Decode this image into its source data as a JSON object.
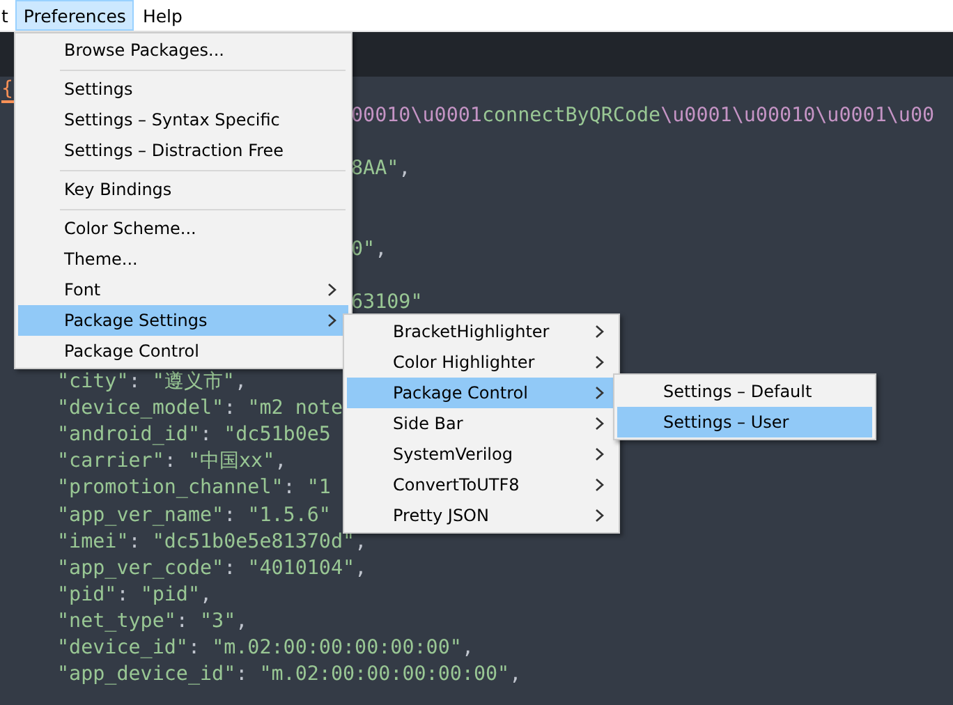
{
  "menu_bar": [
    {
      "label": "t",
      "selected": false
    },
    {
      "label": "Preferences",
      "selected": true
    },
    {
      "label": "Help",
      "selected": false
    }
  ],
  "preferences_menu": {
    "items": [
      {
        "kind": "item",
        "label": "Browse Packages...",
        "selected": false,
        "has_submenu": false
      },
      {
        "kind": "separator"
      },
      {
        "kind": "item",
        "label": "Settings",
        "selected": false,
        "has_submenu": false
      },
      {
        "kind": "item",
        "label": "Settings – Syntax Specific",
        "selected": false,
        "has_submenu": false
      },
      {
        "kind": "item",
        "label": "Settings – Distraction Free",
        "selected": false,
        "has_submenu": false
      },
      {
        "kind": "separator"
      },
      {
        "kind": "item",
        "label": "Key Bindings",
        "selected": false,
        "has_submenu": false
      },
      {
        "kind": "separator"
      },
      {
        "kind": "item",
        "label": "Color Scheme...",
        "selected": false,
        "has_submenu": false
      },
      {
        "kind": "item",
        "label": "Theme...",
        "selected": false,
        "has_submenu": false
      },
      {
        "kind": "item",
        "label": "Font",
        "selected": false,
        "has_submenu": true
      },
      {
        "kind": "item",
        "label": "Package Settings",
        "selected": true,
        "has_submenu": true
      },
      {
        "kind": "item",
        "label": "Package Control",
        "selected": false,
        "has_submenu": false
      }
    ]
  },
  "package_settings_submenu": {
    "items": [
      {
        "kind": "item",
        "label": "BracketHighlighter",
        "selected": false,
        "has_submenu": true
      },
      {
        "kind": "item",
        "label": "Color Highlighter",
        "selected": false,
        "has_submenu": true
      },
      {
        "kind": "item",
        "label": "Package Control",
        "selected": true,
        "has_submenu": true
      },
      {
        "kind": "item",
        "label": "Side Bar",
        "selected": false,
        "has_submenu": true
      },
      {
        "kind": "item",
        "label": "SystemVerilog",
        "selected": false,
        "has_submenu": true
      },
      {
        "kind": "item",
        "label": "ConvertToUTF8",
        "selected": false,
        "has_submenu": true
      },
      {
        "kind": "item",
        "label": "Pretty JSON",
        "selected": false,
        "has_submenu": true
      }
    ]
  },
  "package_control_submenu": {
    "items": [
      {
        "kind": "item",
        "label": "Settings – Default",
        "selected": false,
        "has_submenu": false
      },
      {
        "kind": "item",
        "label": "Settings – User",
        "selected": true,
        "has_submenu": false
      }
    ]
  },
  "editor": {
    "lines": [
      {
        "kind": "top",
        "tokens": [
          {
            "text": "{",
            "kind": "brace"
          }
        ]
      },
      {
        "kind": "after-menu",
        "tokens": [
          {
            "text": "00010\\u0001",
            "kind": "escape"
          },
          {
            "text": "connectByQRCode",
            "kind": "string"
          },
          {
            "text": "\\u0001\\u00010\\u0001\\u00",
            "kind": "escape"
          }
        ]
      },
      {
        "kind": "blank"
      },
      {
        "kind": "after-menu",
        "tokens": [
          {
            "text": "8AA\"",
            "kind": "string"
          },
          {
            "text": ",",
            "kind": "punctuation"
          }
        ]
      },
      {
        "kind": "blank"
      },
      {
        "kind": "blank"
      },
      {
        "kind": "after-menu",
        "tokens": [
          {
            "text": "0\"",
            "kind": "string"
          },
          {
            "text": ",",
            "kind": "punctuation"
          }
        ]
      },
      {
        "kind": "blank"
      },
      {
        "kind": "after-menu",
        "tokens": [
          {
            "text": "63109\"",
            "kind": "string"
          }
        ]
      },
      {
        "kind": "blank"
      },
      {
        "kind": "blank"
      },
      {
        "kind": "indented",
        "tokens": [
          {
            "text": "\"city\"",
            "kind": "string"
          },
          {
            "text": ": ",
            "kind": "punctuation"
          },
          {
            "text": "\"遵义市\"",
            "kind": "string"
          },
          {
            "text": ",",
            "kind": "punctuation"
          }
        ]
      },
      {
        "kind": "indented",
        "tokens": [
          {
            "text": "\"device_model\"",
            "kind": "string"
          },
          {
            "text": ": ",
            "kind": "punctuation"
          },
          {
            "text": "\"m2 note",
            "kind": "string"
          }
        ]
      },
      {
        "kind": "indented",
        "tokens": [
          {
            "text": "\"android_id\"",
            "kind": "string"
          },
          {
            "text": ": ",
            "kind": "punctuation"
          },
          {
            "text": "\"dc51b0e5",
            "kind": "string"
          }
        ]
      },
      {
        "kind": "indented",
        "tokens": [
          {
            "text": "\"carrier\"",
            "kind": "string"
          },
          {
            "text": ": ",
            "kind": "punctuation"
          },
          {
            "text": "\"中国xx\"",
            "kind": "string"
          },
          {
            "text": ",",
            "kind": "punctuation"
          }
        ]
      },
      {
        "kind": "indented",
        "tokens": [
          {
            "text": "\"promotion_channel\"",
            "kind": "string"
          },
          {
            "text": ": ",
            "kind": "punctuation"
          },
          {
            "text": "\"1",
            "kind": "string"
          }
        ]
      },
      {
        "kind": "indented",
        "tokens": [
          {
            "text": "\"app_ver_name\"",
            "kind": "string"
          },
          {
            "text": ": ",
            "kind": "punctuation"
          },
          {
            "text": "\"1.5.6\"",
            "kind": "string"
          }
        ]
      },
      {
        "kind": "indented",
        "tokens": [
          {
            "text": "\"imei\"",
            "kind": "string"
          },
          {
            "text": ": ",
            "kind": "punctuation"
          },
          {
            "text": "\"dc51b0e5e81370d\"",
            "kind": "string"
          },
          {
            "text": ",",
            "kind": "punctuation"
          }
        ]
      },
      {
        "kind": "indented",
        "tokens": [
          {
            "text": "\"app_ver_code\"",
            "kind": "string"
          },
          {
            "text": ": ",
            "kind": "punctuation"
          },
          {
            "text": "\"4010104\"",
            "kind": "string"
          },
          {
            "text": ",",
            "kind": "punctuation"
          }
        ]
      },
      {
        "kind": "indented",
        "tokens": [
          {
            "text": "\"pid\"",
            "kind": "string"
          },
          {
            "text": ": ",
            "kind": "punctuation"
          },
          {
            "text": "\"pid\"",
            "kind": "string"
          },
          {
            "text": ",",
            "kind": "punctuation"
          }
        ]
      },
      {
        "kind": "indented",
        "tokens": [
          {
            "text": "\"net_type\"",
            "kind": "string"
          },
          {
            "text": ": ",
            "kind": "punctuation"
          },
          {
            "text": "\"3\"",
            "kind": "string"
          },
          {
            "text": ",",
            "kind": "punctuation"
          }
        ]
      },
      {
        "kind": "indented",
        "tokens": [
          {
            "text": "\"device_id\"",
            "kind": "string"
          },
          {
            "text": ": ",
            "kind": "punctuation"
          },
          {
            "text": "\"m.02:00:00:00:00:00\"",
            "kind": "string"
          },
          {
            "text": ",",
            "kind": "punctuation"
          }
        ]
      },
      {
        "kind": "indented",
        "tokens": [
          {
            "text": "\"app_device_id\"",
            "kind": "string"
          },
          {
            "text": ": ",
            "kind": "punctuation"
          },
          {
            "text": "\"m.02:00:00:00:00:00\"",
            "kind": "string"
          },
          {
            "text": ",",
            "kind": "punctuation"
          }
        ]
      }
    ]
  }
}
